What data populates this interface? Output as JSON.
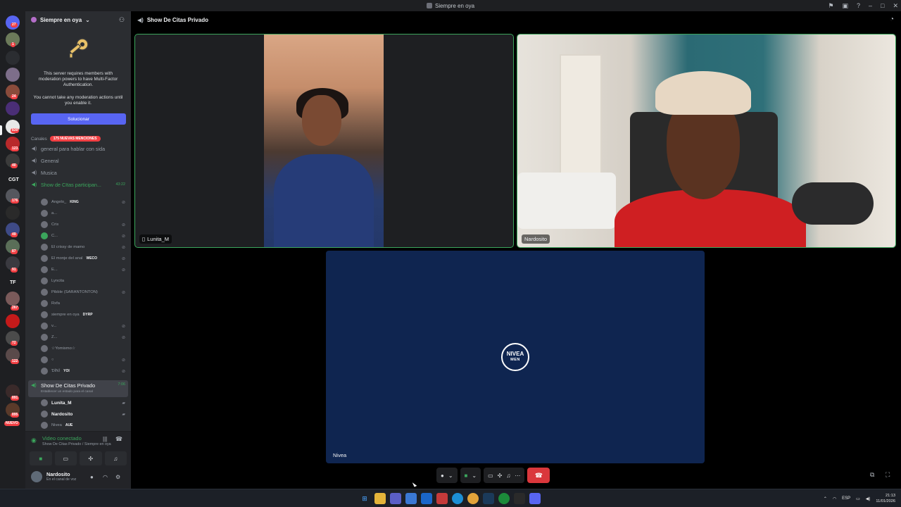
{
  "window": {
    "title": "Siempre en oya"
  },
  "server": {
    "name": "Siempre en oya"
  },
  "mfa": {
    "line1": "This server requires members with moderation powers to have Multi-Factor Authentication.",
    "line2": "You cannot take any moderation actions until you enable it.",
    "button": "Solucionar"
  },
  "sidebar": {
    "category": "Canales",
    "mentions": "175 NUEVAS MENCIONES",
    "channels": [
      {
        "name": "general para hablar con sida",
        "icon": "speaker-icon"
      },
      {
        "name": "General",
        "icon": "speaker-icon"
      },
      {
        "name": "Musica",
        "icon": "speaker-icon"
      },
      {
        "name": "Show de CItas participan...",
        "timer": "43:22",
        "icon": "speaker-icon"
      }
    ],
    "members": [
      {
        "name": "Angelo_",
        "tag": "KING"
      },
      {
        "name": "a..."
      },
      {
        "name": "Cris"
      },
      {
        "name": "C..."
      },
      {
        "name": "El crissy de mamo"
      },
      {
        "name": "El monje del anal",
        "tag": "WECO"
      },
      {
        "name": "E..."
      },
      {
        "name": "Lyncita"
      },
      {
        "name": "Pibble (SARANTONTON)"
      },
      {
        "name": "Rxfa"
      },
      {
        "name": "siempre en oya",
        "tag": "DYRP"
      },
      {
        "name": "v..."
      },
      {
        "name": "Z..."
      },
      {
        "name": "☆Yomismo☆"
      },
      {
        "name": "○"
      },
      {
        "name": "ƊĪNĪ",
        "tag": "YOI"
      }
    ],
    "private_channel": {
      "name": "Show De Citas Privado",
      "sub": "Establecer un estado para el canal",
      "timer": "7:06"
    },
    "private_members": [
      {
        "name": "Lunita_M"
      },
      {
        "name": "Nardosito"
      },
      {
        "name": "Nivea",
        "tag": "AUE"
      }
    ]
  },
  "voice_panel": {
    "title": "Video conectado",
    "sub": "Show De Citas Privado / Siempre en oya"
  },
  "user": {
    "name": "Nardosito",
    "status": "En el canal de voz"
  },
  "stage": {
    "header": "Show De Citas Privado",
    "tiles": [
      {
        "label": "Lunita_M"
      },
      {
        "label": "Nardosito"
      },
      {
        "label": "Nivea",
        "logo_top": "NIVEA",
        "logo_bottom": "MEN"
      }
    ]
  },
  "rail": {
    "badges": [
      "27",
      "1",
      "24",
      "839",
      "123",
      "40",
      "CGT",
      "176",
      "49",
      "87",
      "91",
      "TF",
      "267",
      "72",
      "122",
      "891",
      "895",
      "NUEVO"
    ]
  },
  "taskbar": {
    "lang": "ESP",
    "time": "21:13",
    "date": "11/01/2026"
  }
}
